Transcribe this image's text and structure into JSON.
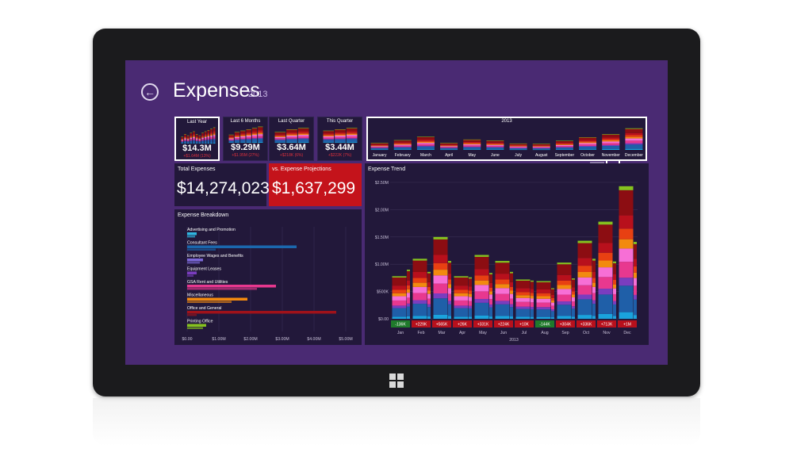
{
  "header": {
    "title": "Expenses",
    "year": "2013"
  },
  "period_tiles": [
    {
      "label": "Last Year",
      "value": "$14.3M",
      "delta": "+$1.64M (13%)",
      "active": true
    },
    {
      "label": "Last 6 Months",
      "value": "$9.29M",
      "delta": "+$1.95M (27%)",
      "active": false
    },
    {
      "label": "Last Quarter",
      "value": "$3.64M",
      "delta": "+$218K (6%)",
      "active": false
    },
    {
      "label": "This Quarter",
      "value": "$3.44M",
      "delta": "+$222K (7%)",
      "active": false
    }
  ],
  "timeline": {
    "year": "2013",
    "months": [
      "January",
      "February",
      "March",
      "April",
      "May",
      "June",
      "July",
      "August",
      "September",
      "October",
      "November",
      "December"
    ]
  },
  "total_expenses": {
    "label": "Total Expenses",
    "value": "$14,274,023"
  },
  "projections": {
    "label": "vs. Expense Projections",
    "value": "$1,637,299"
  },
  "colors": {
    "screen_bg": "#4a2a73",
    "panel_bg": "#22183a",
    "projection_red": "#c4131b",
    "positive_badge": "#b8101c",
    "negative_badge": "#1f7a2b",
    "stack": [
      "#1aa3dd",
      "#1f5fa8",
      "#7a3dbf",
      "#e8388f",
      "#f76fd6",
      "#f28a0f",
      "#e84012",
      "#b8101c",
      "#8c0d12",
      "#86c21f"
    ]
  },
  "breakdown": {
    "title": "Expense Breakdown",
    "categories": [
      "Advertising and Promotion",
      "Consultant Fees",
      "Employee Wages and Benefits",
      "Equipment Leases",
      "GSA Rent and Utilities",
      "Miscellaneous",
      "Office and General",
      "Printing Office"
    ],
    "bar_colors": [
      "#2fb6e0",
      "#1b67ad",
      "#7b68d8",
      "#7a3dbf",
      "#e8388f",
      "#f28a0f",
      "#a0121a",
      "#86c21f"
    ],
    "x_ticks": [
      "$0.00",
      "$1.00M",
      "$2.00M",
      "$3.00M",
      "$4.00M",
      "$5.00M"
    ],
    "xlim": [
      0,
      5000000
    ]
  },
  "chart_data": {
    "type": "bar",
    "title": "Expense Trend",
    "categories": [
      "Jan",
      "Feb",
      "Mar",
      "Apr",
      "May",
      "Jun",
      "Jul",
      "Aug",
      "Sep",
      "Oct",
      "Nov",
      "Dec"
    ],
    "xlabel": "2013",
    "ylabel": "",
    "y_ticks": [
      "$0.00",
      "$500K",
      "$1.00M",
      "$1.50M",
      "$2.00M",
      "$2.50M"
    ],
    "ylim": [
      0,
      2500000
    ],
    "stacked": true,
    "series_note_badges": [
      "-136K",
      "+229K",
      "+565K",
      "+26K",
      "+331K",
      "+224K",
      "+10K",
      "-144K",
      "+304K",
      "+336K",
      "+713K",
      "+1M"
    ],
    "totals": [
      780000,
      1100000,
      1500000,
      780000,
      1170000,
      1060000,
      720000,
      690000,
      1030000,
      1430000,
      1780000,
      2430000
    ],
    "projected": [
      900000,
      860000,
      1060000,
      760000,
      840000,
      860000,
      700000,
      560000,
      740000,
      1100000,
      1050000,
      1410000
    ]
  }
}
